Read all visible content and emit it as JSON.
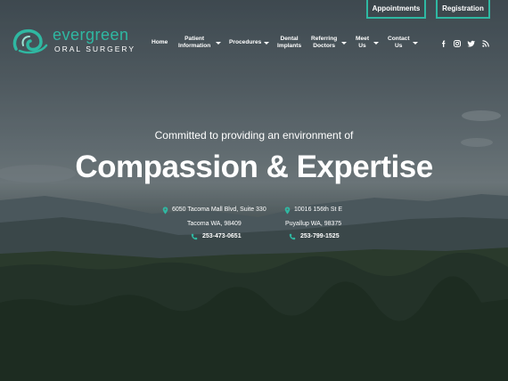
{
  "header": {
    "appointments_label": "Appointments",
    "registration_label": "Registration"
  },
  "logo": {
    "wordmark": "evergreen",
    "subtitle": "ORAL SURGERY"
  },
  "nav": {
    "home": "Home",
    "patient_line1": "Patient",
    "patient_line2": "Information",
    "procedures": "Procedures",
    "implants_line1": "Dental",
    "implants_line2": "Implants",
    "referring_line1": "Referring",
    "referring_line2": "Doctors",
    "meet_line1": "Meet",
    "meet_line2": "Us",
    "contact_line1": "Contact",
    "contact_line2": "Us"
  },
  "social": [
    "facebook-icon",
    "instagram-icon",
    "twitter-icon",
    "rss-icon"
  ],
  "hero": {
    "tagline": "Committed to providing an environment of",
    "headline": "Compassion & Expertise"
  },
  "locations": [
    {
      "address1": "6050 Tacoma Mall Blvd, Suite 330",
      "address2": "Tacoma WA, 98409",
      "phone": "253-473-0651"
    },
    {
      "address1": "10016 156th St E",
      "address2": "Puyallup WA, 98375",
      "phone": "253-799-1525"
    }
  ],
  "colors": {
    "accent": "#2fb8a2",
    "text": "#ffffff"
  }
}
